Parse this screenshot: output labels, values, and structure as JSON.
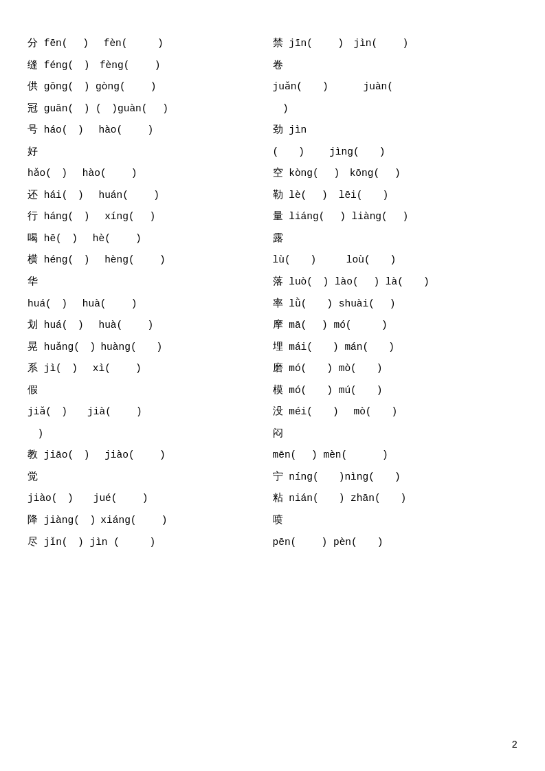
{
  "page": {
    "number": "2",
    "rows": [
      {
        "left": "分 fēn(　　)　　fèn(　　　　)",
        "right": "禁 jīn(　　　　)　jìn(　　　　)"
      },
      {
        "left": "缝 féng(　　)　 fèng(　　　　)",
        "right": "卷"
      },
      {
        "left": "供 gōng(　　) gòng(　　　　)",
        "right": "juǎn(　　　　)　　　　juàn("
      },
      {
        "left": "冠 guān(　　) (　　)guàn(　　)",
        "right": "　)"
      },
      {
        "left": "号 háo(　　)　　hào(　　　　)",
        "right": "劲 jìn"
      },
      {
        "left": "好",
        "right": "(　　　　)　　　　jìng(　　　　)"
      },
      {
        "left": "hǎo(　　)　　hào(　　　　)",
        "right": "空 kòng(　　　　)　kōng(　　　　)"
      },
      {
        "left": "还 hái(　　)　　huán(　　　　)",
        "right": "勒 lè(　　　　) lēi(　　　　)"
      },
      {
        "left": "行 háng(　　)　　xíng(　　　　)",
        "right": "量 liáng(　　　　) liàng(　　　　)"
      },
      {
        "left": "喝 hē(　　)　　hè(　　　　)",
        "right": "露"
      },
      {
        "left": "横 héng(　　)　　hèng(　　　　)",
        "right": "lù(　　　　)　　　　loù(　　　　)"
      },
      {
        "left": "华",
        "right": "落 luò(　　) lào(　　　) là(　　　　)"
      },
      {
        "left": "huá(　　)　　huà(　　　　)",
        "right": "率 lǜ(　　　　) shuài(　　　　)"
      },
      {
        "left": "划 huá(　　)　　huà(　　　　)",
        "right": "摩 mā(　　　) mó(　　　　　　)"
      },
      {
        "left": "晃 huǎng(　　)　 huàng(　　　　)",
        "right": "埋 mái(　　　　) mán(　　　　)"
      },
      {
        "left": "系 jì(　　)　　xì(　　　　)",
        "right": "磨 mó(　　　　) mò(　　　　)"
      },
      {
        "left": "假",
        "right": "模 mó(　　　　) mú(　　　　)"
      },
      {
        "left": "jiǎ(　　)　　　jià(　　　　)",
        "right": "没 méi(　　　　)　　mò(　　　　)"
      },
      {
        "left": "　　)",
        "right": "闷"
      },
      {
        "left": "教 jiāo(　　)　　jiào(　　　　)",
        "right": "mēn(　　　) mèn(　　　　　　)"
      },
      {
        "left": "觉",
        "right": "宁 níng(　　　　)nìng(　　　　)"
      },
      {
        "left": "jiào(　　)　　　jué(　　　　)",
        "right": "粘 nián(　　　　) zhān(　　　　)"
      },
      {
        "left": "降 jiàng(　　)　 xiáng(　　　　)",
        "right": "喷"
      },
      {
        "left": "尽 jǐn(　　) jìn (　　　　)",
        "right": "pēn(　　　　) pèn(　　　　)"
      }
    ]
  }
}
